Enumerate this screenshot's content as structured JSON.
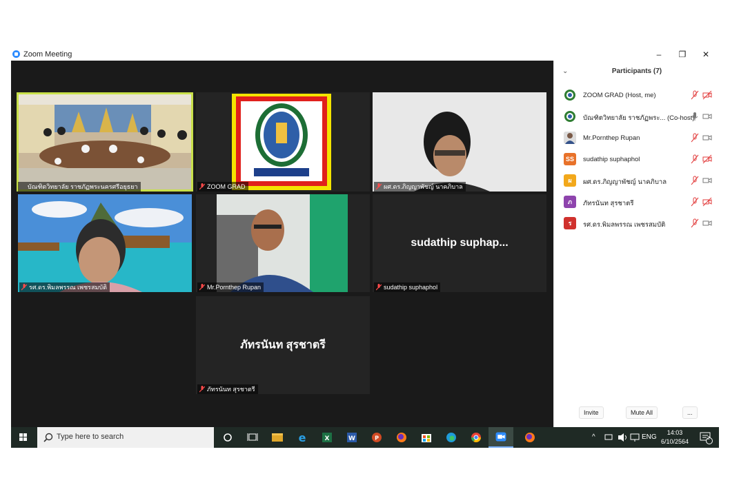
{
  "window": {
    "title": "Zoom Meeting",
    "minimize_glyph": "–",
    "restore_glyph": "❐",
    "close_glyph": "✕"
  },
  "gallery": {
    "tiles": [
      {
        "name": "บัณฑิตวิทยาลัย ราชภัฏพระนครศรีอยุธยา",
        "video": "meeting-room",
        "muted": false,
        "active": true
      },
      {
        "name": "ZOOM GRAD",
        "video": "university-logo",
        "muted": true
      },
      {
        "name": "ผศ.ดร.ภิญญาพัชญ์ นาคภิบาล",
        "video": "woman-glasses",
        "muted": true
      },
      {
        "name": "รศ.ดร.พิมลพรรณ เพชรสมบัติ",
        "video": "beach-background",
        "muted": true
      },
      {
        "name": "Mr.Pornthep Rupan",
        "video": "man-glasses",
        "muted": true
      },
      {
        "name": "sudathip suphaphol",
        "display": "sudathip suphap...",
        "muted": true
      },
      {
        "name": "ภัทรนันท สุรชาตรี",
        "display": "ภัทรนันท สุรชาตรี",
        "muted": true
      }
    ]
  },
  "participants": {
    "header": "Participants (7)",
    "collapse_glyph": "⌄",
    "list": [
      {
        "name": "ZOOM GRAD (Host, me)",
        "avatar": "logo",
        "color": "#2f7d32",
        "mic": "muted",
        "cam": "off"
      },
      {
        "name": "บัณฑิตวิทยาลัย ราชภัฏพระ... (Co-host)",
        "avatar": "logo",
        "color": "#2f7d32",
        "mic": "on",
        "cam": "on"
      },
      {
        "name": "Mr.Pornthep Rupan",
        "avatar": "photo",
        "color": "#555555",
        "mic": "muted",
        "cam": "on"
      },
      {
        "name": "sudathip suphaphol",
        "avatar": "SS",
        "color": "#e8722a",
        "mic": "muted",
        "cam": "off"
      },
      {
        "name": "ผศ.ดร.ภิญญาพัชญ์ นาคภิบาล",
        "avatar": "ผ",
        "color": "#f2a81b",
        "mic": "muted",
        "cam": "on"
      },
      {
        "name": "ภัทรนันท สุรชาตรี",
        "avatar": "ภ",
        "color": "#8e44ad",
        "mic": "muted",
        "cam": "off"
      },
      {
        "name": "รศ.ดร.พิมลพรรณ เพชรสมบัติ",
        "avatar": "ร",
        "color": "#d0312d",
        "mic": "muted",
        "cam": "on"
      }
    ],
    "invite_label": "Invite",
    "mute_all_label": "Mute All",
    "more_label": "..."
  },
  "taskbar": {
    "search_placeholder": "Type here to search",
    "tray_up": "^",
    "language": "ENG",
    "time": "14:03",
    "date": "6/10/2564",
    "notifications": "2",
    "apps": [
      "task-view",
      "multitasking",
      "file-explorer",
      "internet-explorer",
      "excel",
      "word",
      "powerpoint",
      "firefox",
      "store",
      "edge",
      "chrome",
      "zoom",
      "firefox"
    ]
  }
}
